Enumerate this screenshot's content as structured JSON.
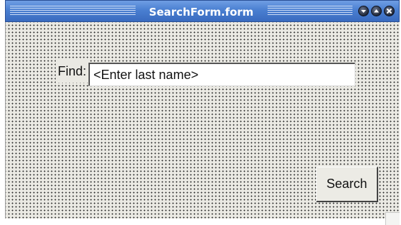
{
  "window": {
    "title": "SearchForm.form",
    "controls": [
      "minimize-icon",
      "maximize-icon",
      "close-icon"
    ]
  },
  "form": {
    "find_label": "Find:",
    "find_input_value": "<Enter last name>",
    "search_button_label": "Search"
  },
  "colors": {
    "titlebar": "#4a7fd1",
    "canvas": "#eae9e3",
    "grid_dot": "#2b2b2b"
  }
}
